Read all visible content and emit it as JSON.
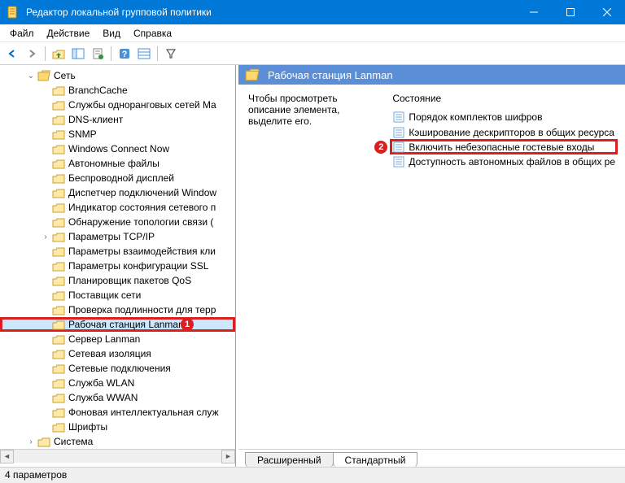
{
  "window": {
    "title": "Редактор локальной групповой политики"
  },
  "menu": {
    "file": "Файл",
    "action": "Действие",
    "view": "Вид",
    "help": "Справка"
  },
  "tree": {
    "root": "Сеть",
    "items": [
      "BranchCache",
      "Службы одноранговых сетей Ma",
      "DNS-клиент",
      "SNMP",
      "Windows Connect Now",
      "Автономные файлы",
      "Беспроводной дисплей",
      "Диспетчер подключений Window",
      "Индикатор состояния сетевого п",
      "Обнаружение топологии связи (",
      "Параметры TCP/IP",
      "Параметры взаимодействия кли",
      "Параметры конфигурации SSL",
      "Планировщик пакетов QoS",
      "Поставщик сети",
      "Проверка подлинности для терр",
      "Рабочая станция Lanman",
      "Сервер Lanman",
      "Сетевая изоляция",
      "Сетевые подключения",
      "Служба WLAN",
      "Служба WWAN",
      "Фоновая интеллектуальная служ",
      "Шрифты"
    ],
    "after_root": "Система"
  },
  "right": {
    "title": "Рабочая станция Lanman",
    "desc": "Чтобы просмотреть описание элемента, выделите его.",
    "column_state": "Состояние",
    "settings": [
      "Порядок комплектов шифров",
      "Кэширование дескрипторов в общих ресурса",
      "Включить небезопасные гостевые входы",
      "Доступность автономных файлов в общих ре"
    ]
  },
  "tabs": {
    "extended": "Расширенный",
    "standard": "Стандартный"
  },
  "status": "4 параметров",
  "badges": {
    "one": "1",
    "two": "2"
  }
}
